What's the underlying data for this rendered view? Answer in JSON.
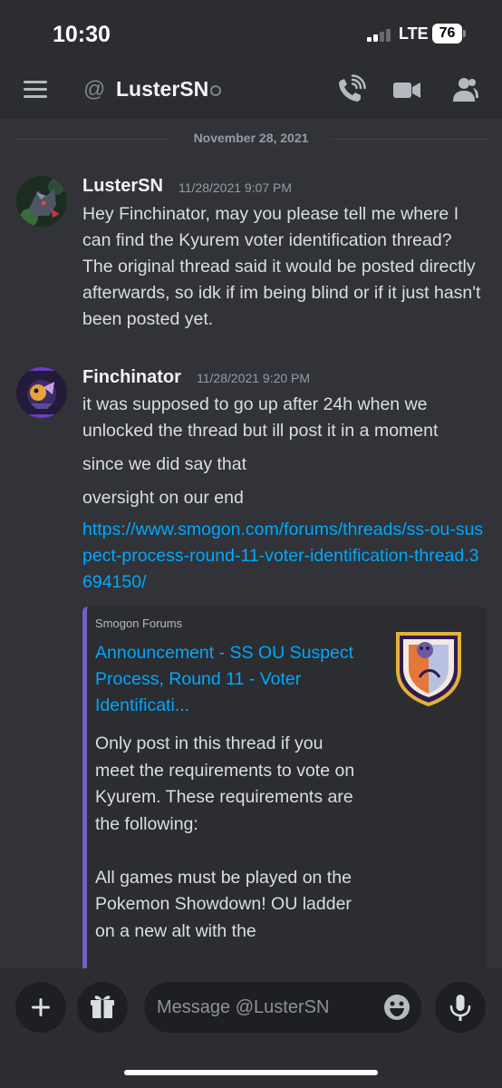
{
  "status_bar": {
    "time": "10:30",
    "network": "LTE",
    "battery": "76"
  },
  "header": {
    "at_symbol": "@",
    "title": "LusterSN",
    "icons": [
      "menu-icon",
      "at-icon",
      "call-icon",
      "video-icon",
      "members-icon"
    ]
  },
  "date_divider": "November 28, 2021",
  "messages": [
    {
      "author": "LusterSN",
      "timestamp": "11/28/2021 9:07 PM",
      "text": "Hey Finchinator, may you please tell me where I can find the Kyurem voter identification thread? The original thread said it would be posted directly afterwards, so idk if im being blind or if it just hasn't been posted yet."
    },
    {
      "author": "Finchinator",
      "timestamp": "11/28/2021 9:20 PM",
      "text": "it was supposed to go up after 24h when we unlocked the thread but ill post it in a moment",
      "followups": [
        "since we did say that",
        "oversight on our end"
      ],
      "link": "https://www.smogon.com/forums/threads/ss-ou-suspect-process-round-11-voter-identification-thread.3694150/"
    }
  ],
  "embed": {
    "provider": "Smogon Forums",
    "title": "Announcement - SS OU Suspect Process, Round 11 - Voter Identificati...",
    "description_p1": "Only post in this thread if you meet the requirements to vote on Kyurem. These requirements are the following:",
    "description_p2": "All games must be played on the Pokemon Showdown! OU ladder on a new alt with the"
  },
  "composer": {
    "placeholder": "Message @LusterSN"
  },
  "colors": {
    "background": "#313338",
    "header": "#2b2d31",
    "link": "#00a8fc",
    "embed_accent": "#7560c2"
  }
}
